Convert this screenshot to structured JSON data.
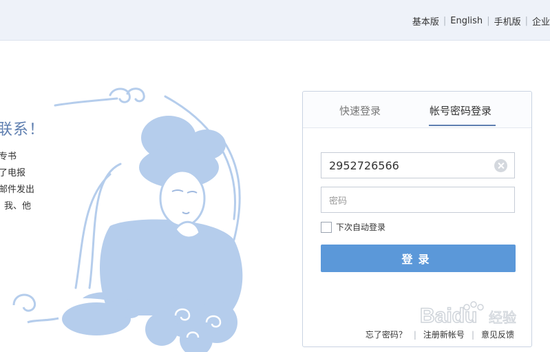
{
  "topbar": {
    "links": [
      "基本版",
      "English",
      "手机版",
      "企业"
    ]
  },
  "left_panel": {
    "title": "联系！",
    "lines": [
      "专书",
      "了电报",
      "邮件发出",
      "我、他"
    ]
  },
  "login": {
    "tabs": [
      {
        "label": "快速登录",
        "active": false
      },
      {
        "label": "帐号密码登录",
        "active": true
      }
    ],
    "account_value": "2952726566",
    "password_placeholder": "密码",
    "remember_label": "下次自动登录",
    "submit_label": "登录",
    "footer_links": [
      "忘了密码？",
      "注册新帐号",
      "意见反馈"
    ]
  },
  "colors": {
    "accent": "#5f7fb0",
    "button": "#5b98d9",
    "illustration": "#b5cdec",
    "topbar_bg": "#eef2f9"
  },
  "watermark": {
    "brand": "Baidu",
    "suffix": "经验"
  }
}
